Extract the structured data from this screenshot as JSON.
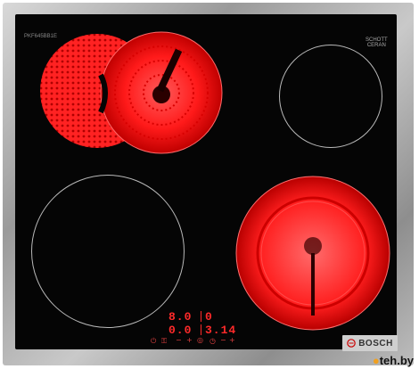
{
  "hob": {
    "model_label": "PKF645BB1E",
    "glass_brand_line1": "SCHOTT",
    "glass_brand_line2": "CERAN"
  },
  "display": {
    "left_top": "8.0",
    "right_top": "0",
    "left_bottom": "0.0",
    "right_bottom": "3.14"
  },
  "controls": {
    "power_icon": "power-icon",
    "lock_icon": "lock-icon",
    "timer_icon": "timer-icon",
    "minus": "−",
    "plus": "+",
    "minus2": "−",
    "plus2": "+",
    "zone_select": "◎"
  },
  "brand": {
    "name": "BOSCH"
  },
  "watermark": {
    "site": "teh.by"
  },
  "colors": {
    "glass": "#050505",
    "zone_hot": "#ff1d1d",
    "display": "#ff2a2a",
    "frame": "#bdbdbd"
  }
}
